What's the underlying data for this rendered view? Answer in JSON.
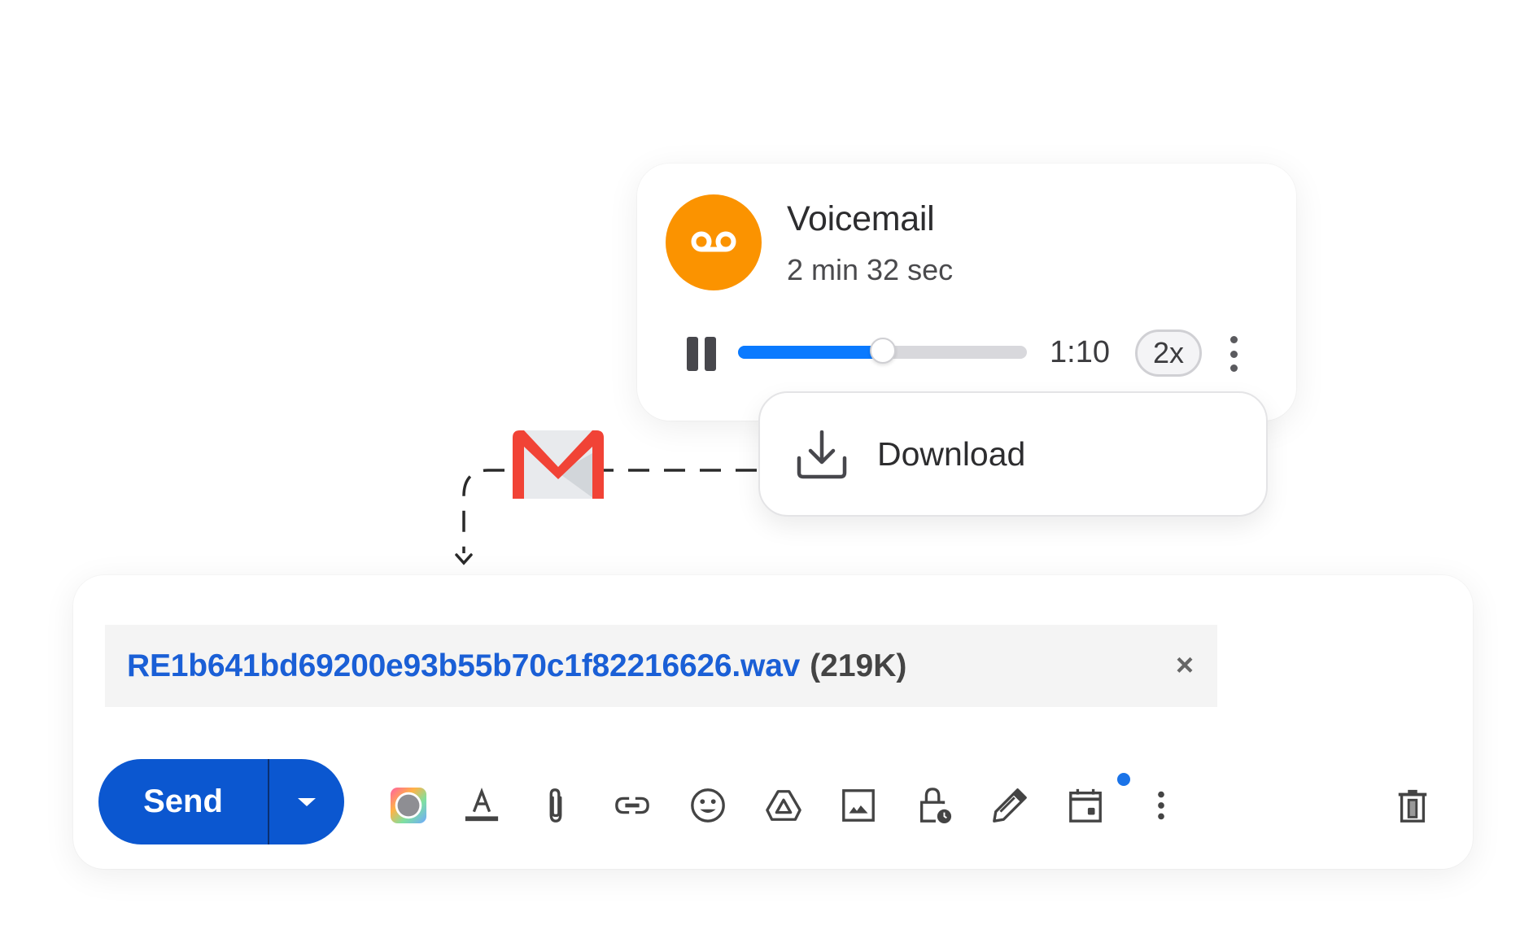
{
  "voicemail": {
    "title": "Voicemail",
    "duration": "2 min 32 sec",
    "icon": "voicemail-icon",
    "accent_color": "#fb9300",
    "player": {
      "state": "playing",
      "control_icon": "pause-icon",
      "progress_fraction": 0.5,
      "elapsed": "1:10",
      "speed": "2x",
      "more_icon": "more-vert-icon",
      "progress_color": "#0a7aff"
    }
  },
  "menu": {
    "items": [
      {
        "label": "Download",
        "icon": "download-icon"
      }
    ]
  },
  "connector": {
    "logo": "gmail-logo",
    "style": "dashed-arrow"
  },
  "compose": {
    "attachment": {
      "filename": "RE1b641bd69200e93b55b70c1f82216626.wav",
      "size": "(219K)",
      "remove_icon": "close-icon",
      "link_color": "#1a5fd6"
    },
    "send_label": "Send",
    "send_options_icon": "arrow-drop-down-icon",
    "send_color": "#0b57d0",
    "toolbar": [
      {
        "name": "gemini-icon",
        "label": "Help me write"
      },
      {
        "name": "format-text-icon",
        "label": "Formatting options"
      },
      {
        "name": "attach-file-icon",
        "label": "Attach files"
      },
      {
        "name": "insert-link-icon",
        "label": "Insert link"
      },
      {
        "name": "emoji-icon",
        "label": "Insert emoji"
      },
      {
        "name": "drive-icon",
        "label": "Insert files using Drive"
      },
      {
        "name": "insert-photo-icon",
        "label": "Insert photo"
      },
      {
        "name": "confidential-mode-icon",
        "label": "Toggle confidential mode"
      },
      {
        "name": "signature-icon",
        "label": "Insert signature"
      },
      {
        "name": "schedule-icon",
        "label": "Set up a time to meet",
        "badge": true
      },
      {
        "name": "more-options-icon",
        "label": "More options"
      }
    ],
    "discard_icon": "trash-icon"
  }
}
